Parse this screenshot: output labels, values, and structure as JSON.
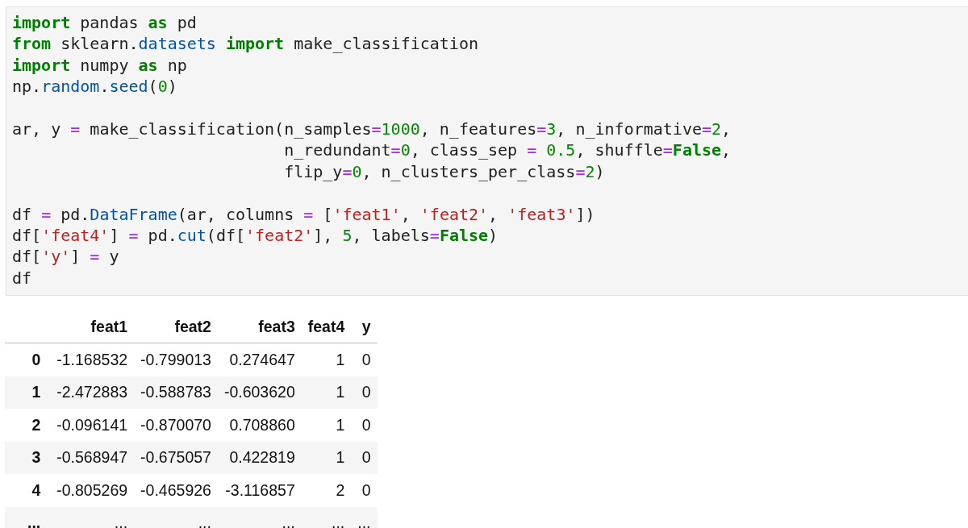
{
  "code_cell": {
    "blocks": [
      {
        "lines": [
          {
            "tokens": [
              {
                "kind": "kw",
                "text": "import"
              },
              {
                "kind": "p",
                "text": " pandas "
              },
              {
                "kind": "kw",
                "text": "as"
              },
              {
                "kind": "p",
                "text": " pd"
              }
            ]
          },
          {
            "tokens": [
              {
                "kind": "kw",
                "text": "from"
              },
              {
                "kind": "p",
                "text": " sklearn."
              },
              {
                "kind": "attr",
                "text": "datasets"
              },
              {
                "kind": "kw",
                "text": " import"
              },
              {
                "kind": "p",
                "text": " make_classification"
              }
            ]
          },
          {
            "tokens": [
              {
                "kind": "kw",
                "text": "import"
              },
              {
                "kind": "p",
                "text": " numpy "
              },
              {
                "kind": "kw",
                "text": "as"
              },
              {
                "kind": "p",
                "text": " np"
              }
            ]
          },
          {
            "tokens": [
              {
                "kind": "p",
                "text": "np."
              },
              {
                "kind": "attr",
                "text": "random"
              },
              {
                "kind": "p",
                "text": "."
              },
              {
                "kind": "attr",
                "text": "seed"
              },
              {
                "kind": "p",
                "text": "("
              },
              {
                "kind": "num",
                "text": "0"
              },
              {
                "kind": "p",
                "text": ")"
              }
            ]
          }
        ]
      },
      {
        "lines": [
          {
            "tokens": [
              {
                "kind": "p",
                "text": "ar, y "
              },
              {
                "kind": "op",
                "text": "="
              },
              {
                "kind": "p",
                "text": " make_classification(n_samples"
              },
              {
                "kind": "op",
                "text": "="
              },
              {
                "kind": "num",
                "text": "1000"
              },
              {
                "kind": "p",
                "text": ", n_features"
              },
              {
                "kind": "op",
                "text": "="
              },
              {
                "kind": "num",
                "text": "3"
              },
              {
                "kind": "p",
                "text": ", n_informative"
              },
              {
                "kind": "op",
                "text": "="
              },
              {
                "kind": "num",
                "text": "2"
              },
              {
                "kind": "p",
                "text": ","
              }
            ]
          },
          {
            "tokens": [
              {
                "kind": "p",
                "text": "                            n_redundant"
              },
              {
                "kind": "op",
                "text": "="
              },
              {
                "kind": "num",
                "text": "0"
              },
              {
                "kind": "p",
                "text": ", class_sep "
              },
              {
                "kind": "op",
                "text": "="
              },
              {
                "kind": "num",
                "text": " 0.5"
              },
              {
                "kind": "p",
                "text": ", shuffle"
              },
              {
                "kind": "op",
                "text": "="
              },
              {
                "kind": "kw",
                "text": "False"
              },
              {
                "kind": "p",
                "text": ","
              }
            ]
          },
          {
            "tokens": [
              {
                "kind": "p",
                "text": "                            flip_y"
              },
              {
                "kind": "op",
                "text": "="
              },
              {
                "kind": "num",
                "text": "0"
              },
              {
                "kind": "p",
                "text": ", n_clusters_per_class"
              },
              {
                "kind": "op",
                "text": "="
              },
              {
                "kind": "num",
                "text": "2"
              },
              {
                "kind": "p",
                "text": ")"
              }
            ]
          }
        ]
      },
      {
        "lines": [
          {
            "tokens": [
              {
                "kind": "p",
                "text": "df "
              },
              {
                "kind": "op",
                "text": "="
              },
              {
                "kind": "p",
                "text": " pd."
              },
              {
                "kind": "attr",
                "text": "DataFrame"
              },
              {
                "kind": "p",
                "text": "(ar, columns "
              },
              {
                "kind": "op",
                "text": "="
              },
              {
                "kind": "p",
                "text": " ["
              },
              {
                "kind": "str",
                "text": "'feat1'"
              },
              {
                "kind": "p",
                "text": ", "
              },
              {
                "kind": "str",
                "text": "'feat2'"
              },
              {
                "kind": "p",
                "text": ", "
              },
              {
                "kind": "str",
                "text": "'feat3'"
              },
              {
                "kind": "p",
                "text": "])"
              }
            ]
          },
          {
            "tokens": [
              {
                "kind": "p",
                "text": "df["
              },
              {
                "kind": "str",
                "text": "'feat4'"
              },
              {
                "kind": "p",
                "text": "] "
              },
              {
                "kind": "op",
                "text": "="
              },
              {
                "kind": "p",
                "text": " pd."
              },
              {
                "kind": "attr",
                "text": "cut"
              },
              {
                "kind": "p",
                "text": "(df["
              },
              {
                "kind": "str",
                "text": "'feat2'"
              },
              {
                "kind": "p",
                "text": "], "
              },
              {
                "kind": "num",
                "text": "5"
              },
              {
                "kind": "p",
                "text": ", labels"
              },
              {
                "kind": "op",
                "text": "="
              },
              {
                "kind": "kw",
                "text": "False"
              },
              {
                "kind": "p",
                "text": ")"
              }
            ]
          },
          {
            "tokens": [
              {
                "kind": "p",
                "text": "df["
              },
              {
                "kind": "str",
                "text": "'y'"
              },
              {
                "kind": "p",
                "text": "] "
              },
              {
                "kind": "op",
                "text": "="
              },
              {
                "kind": "p",
                "text": " y"
              }
            ]
          },
          {
            "tokens": [
              {
                "kind": "p",
                "text": "df"
              }
            ]
          }
        ]
      }
    ]
  },
  "output_table": {
    "columns": [
      "feat1",
      "feat2",
      "feat3",
      "feat4",
      "y"
    ],
    "rows": [
      {
        "index": "0",
        "cells": [
          "-1.168532",
          "-0.799013",
          "0.274647",
          "1",
          "0"
        ]
      },
      {
        "index": "1",
        "cells": [
          "-2.472883",
          "-0.588783",
          "-0.603620",
          "1",
          "0"
        ]
      },
      {
        "index": "2",
        "cells": [
          "-0.096141",
          "-0.870070",
          "0.708860",
          "1",
          "0"
        ]
      },
      {
        "index": "3",
        "cells": [
          "-0.568947",
          "-0.675057",
          "0.422819",
          "1",
          "0"
        ]
      },
      {
        "index": "4",
        "cells": [
          "-0.805269",
          "-0.465926",
          "-3.116857",
          "2",
          "0"
        ]
      },
      {
        "index": "...",
        "cells": [
          "...",
          "...",
          "...",
          "...",
          "..."
        ]
      }
    ]
  }
}
